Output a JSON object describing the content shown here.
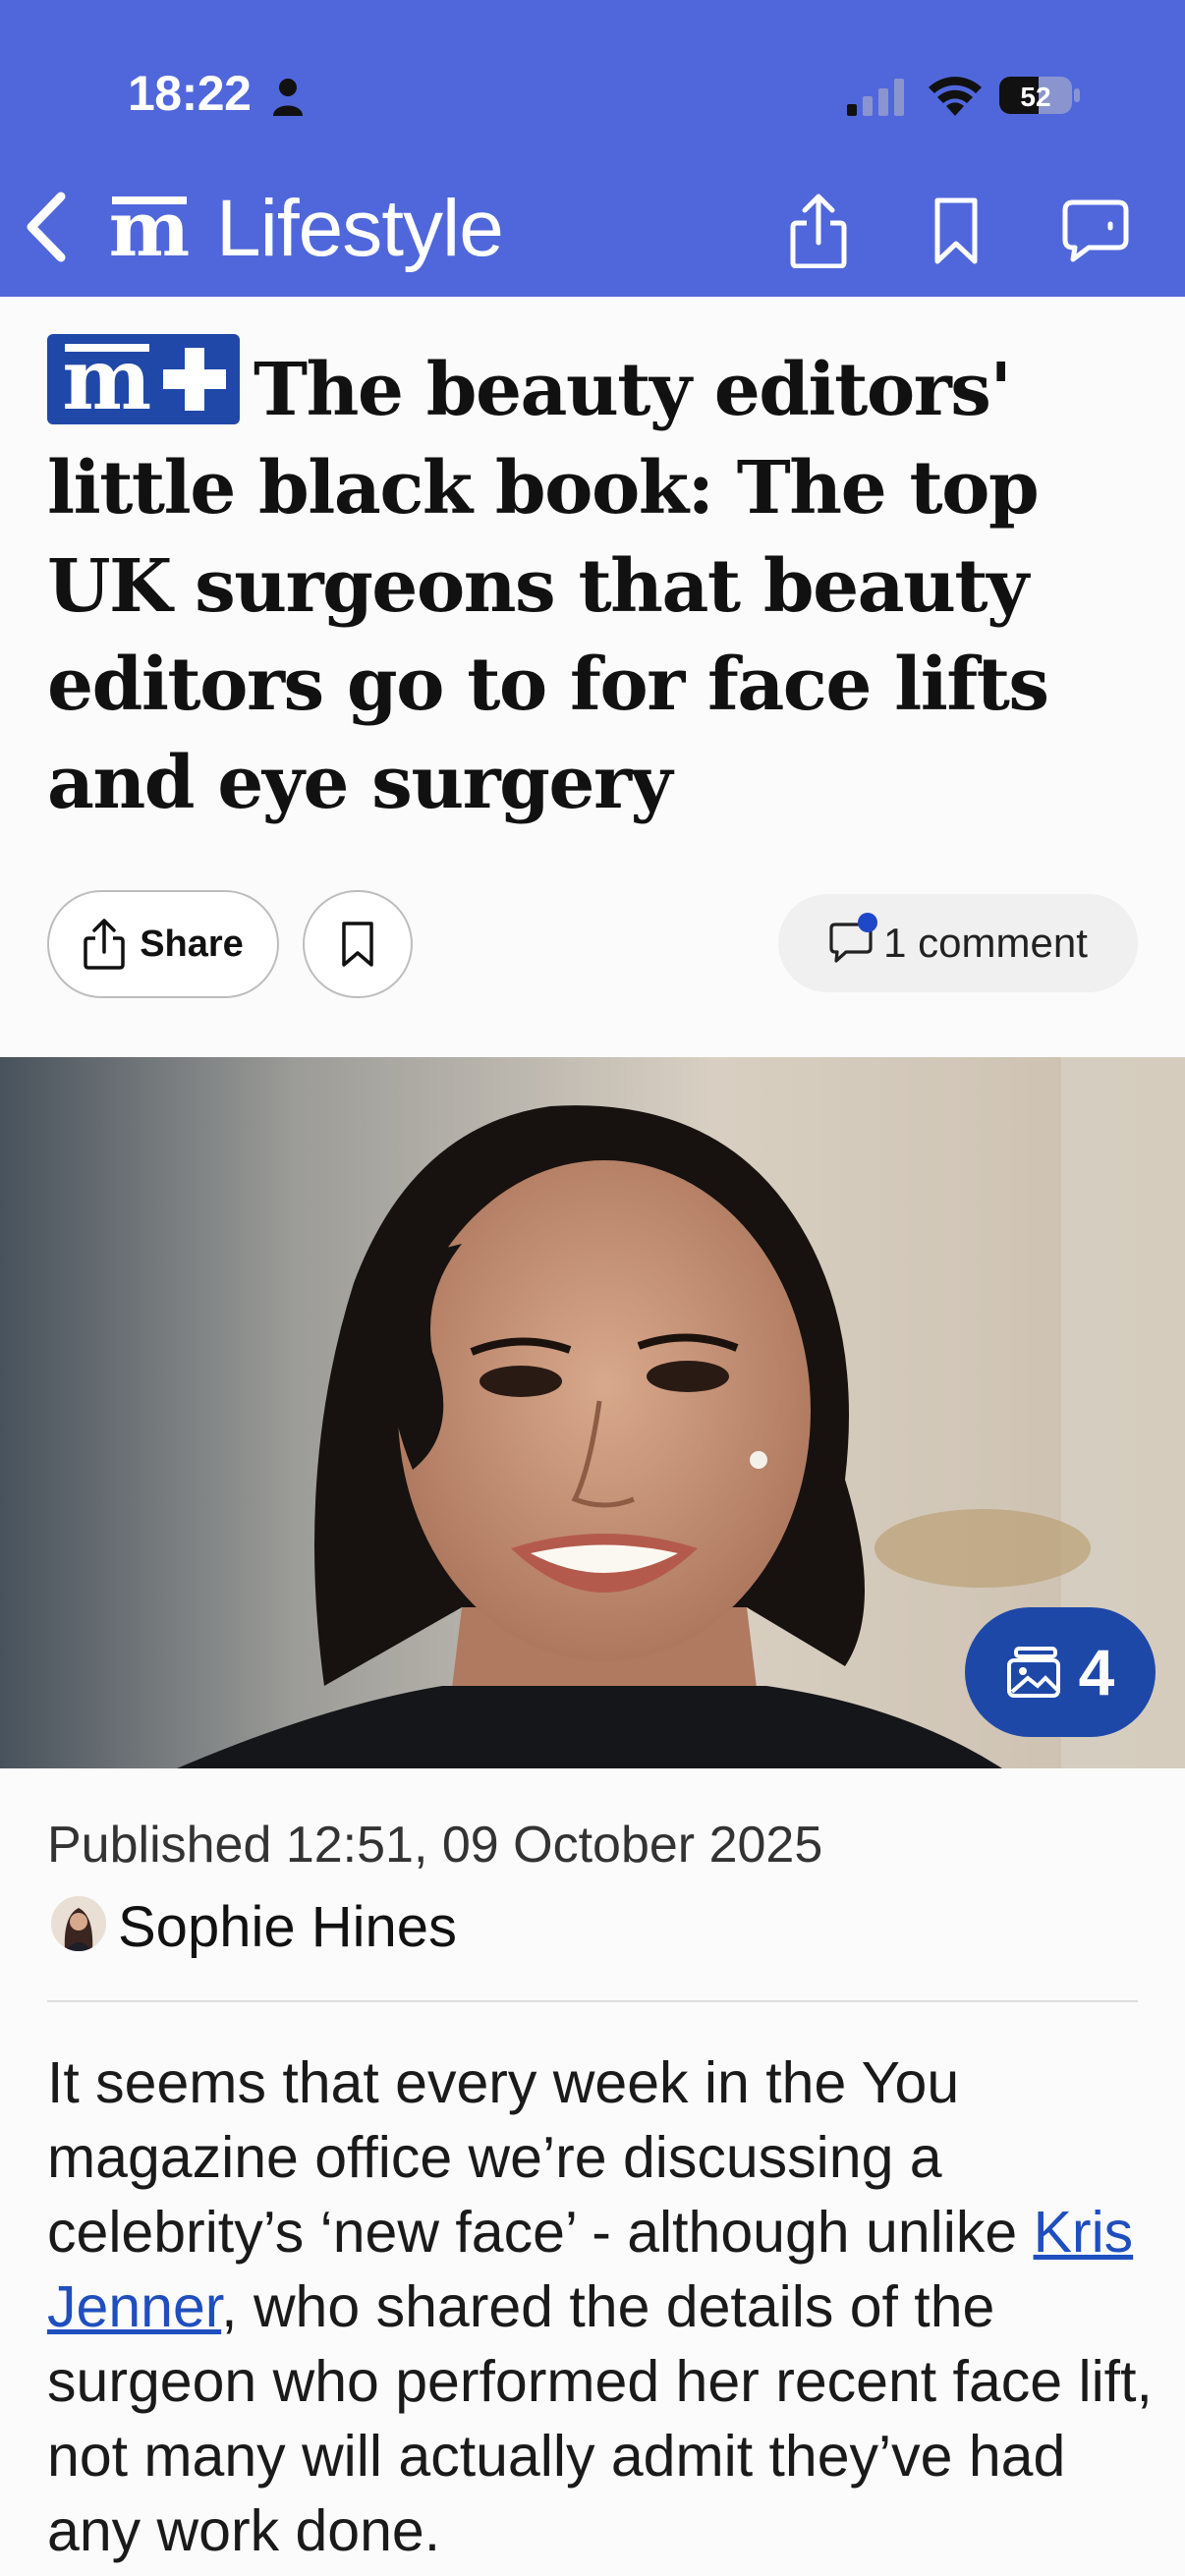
{
  "status_bar": {
    "time": "18:22",
    "battery": "52"
  },
  "nav": {
    "section_title": "Lifestyle"
  },
  "article": {
    "headline": "The beauty editors' little black book: The top UK surgeons that beauty editors go to for face lifts and eye surgery",
    "share_label": "Share",
    "comments_label": "1 comment",
    "gallery_count": "4",
    "published": "Published 12:51, 09 October 2025",
    "author": "Sophie Hines",
    "body_before": "It seems that every week in the You magazine office we’re discussing a celebrity’s ‘new face’ - although unlike ",
    "body_link": "Kris Jenner",
    "body_after": ", who shared the details of the surgeon who performed her recent face lift, not many will actually admit they’ve had any work done."
  },
  "colors": {
    "brand_blue": "#5067db",
    "badge_blue": "#1f48a8",
    "link_blue": "#1f4fbf"
  }
}
